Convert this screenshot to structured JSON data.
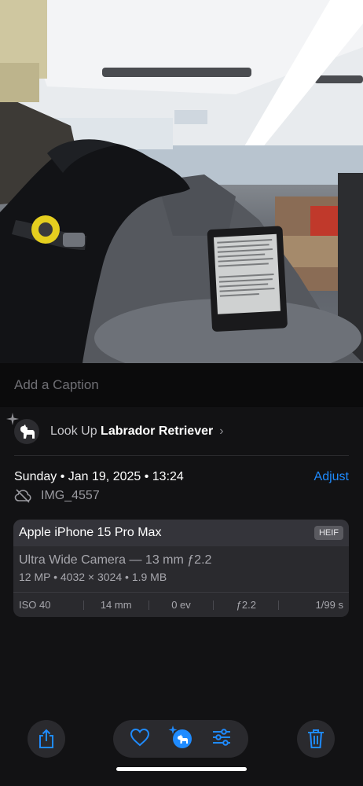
{
  "caption_placeholder": "Add a Caption",
  "lookup": {
    "prefix": "Look Up",
    "subject": "Labrador Retriever"
  },
  "datetime": "Sunday • Jan 19, 2025 • 13:24",
  "adjust_label": "Adjust",
  "file_name": "IMG_4557",
  "camera": {
    "model": "Apple iPhone 15 Pro Max",
    "format": "HEIF",
    "lens": "Ultra Wide Camera — 13 mm ƒ2.2",
    "spec": "12 MP • 4032 × 3024 • 1.9 MB",
    "metrics": [
      "ISO 40",
      "14 mm",
      "0 ev",
      "ƒ2.2",
      "1/99 s"
    ]
  },
  "toolbar": {
    "icons": [
      "share-icon",
      "heart-icon",
      "visual-lookup-icon",
      "adjust-sliders-icon",
      "trash-icon"
    ]
  },
  "colors": {
    "accent": "#1f8bff",
    "background": "#121214"
  }
}
